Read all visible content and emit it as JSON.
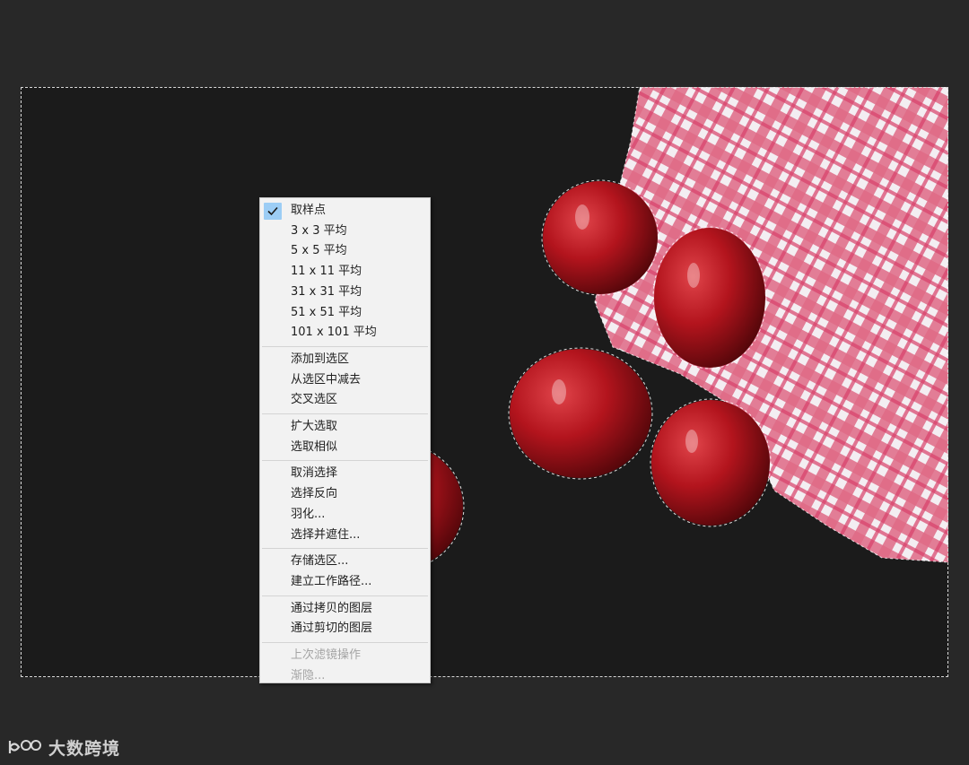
{
  "context_menu": {
    "groups": [
      [
        {
          "label": "取样点",
          "checked": true,
          "enabled": true
        },
        {
          "label": "3 x 3 平均",
          "checked": false,
          "enabled": true
        },
        {
          "label": "5 x 5 平均",
          "checked": false,
          "enabled": true
        },
        {
          "label": "11 x 11 平均",
          "checked": false,
          "enabled": true
        },
        {
          "label": "31 x 31 平均",
          "checked": false,
          "enabled": true
        },
        {
          "label": "51 x 51 平均",
          "checked": false,
          "enabled": true
        },
        {
          "label": "101 x 101 平均",
          "checked": false,
          "enabled": true
        }
      ],
      [
        {
          "label": "添加到选区",
          "enabled": true
        },
        {
          "label": "从选区中减去",
          "enabled": true
        },
        {
          "label": "交叉选区",
          "enabled": true
        }
      ],
      [
        {
          "label": "扩大选取",
          "enabled": true
        },
        {
          "label": "选取相似",
          "enabled": true
        }
      ],
      [
        {
          "label": "取消选择",
          "enabled": true
        },
        {
          "label": "选择反向",
          "enabled": true
        },
        {
          "label": "羽化...",
          "enabled": true
        },
        {
          "label": "选择并遮住...",
          "enabled": true
        }
      ],
      [
        {
          "label": "存储选区...",
          "enabled": true
        },
        {
          "label": "建立工作路径...",
          "enabled": true
        }
      ],
      [
        {
          "label": "通过拷贝的图层",
          "enabled": true
        },
        {
          "label": "通过剪切的图层",
          "enabled": true
        }
      ],
      [
        {
          "label": "上次滤镜操作",
          "enabled": false
        },
        {
          "label": "渐隐...",
          "enabled": false
        }
      ]
    ]
  },
  "icons": {
    "check": "checkmark-icon",
    "watermark_logo": "logo-icon"
  },
  "watermark": {
    "text": "大数跨境"
  },
  "colors": {
    "workspace_bg": "#282828",
    "photo_bg": "#1b1b1b",
    "menu_bg": "#f2f2f2",
    "menu_check_highlight": "#9ccdf5",
    "apple_red": "#a0141c",
    "cloth_red": "#d64a6a"
  }
}
